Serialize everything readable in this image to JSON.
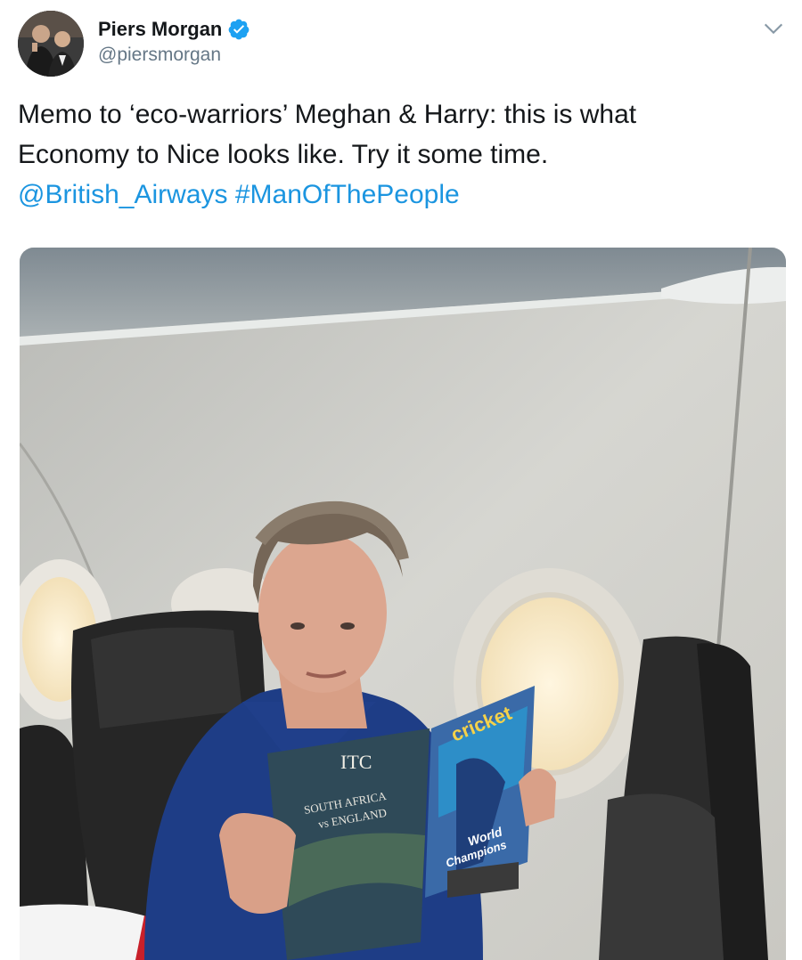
{
  "user": {
    "name": "Piers Morgan",
    "handle": "@piersmorgan",
    "verified_color": "#1da1f2"
  },
  "tweet": {
    "line1": "Memo to ‘eco-warriors’ Meghan & Harry: this is what",
    "line2": "Economy to Nice looks like. Try it some time.",
    "mention": "@British_Airways",
    "hashtag": "#ManOfThePeople",
    "link_color": "#1b95e0"
  },
  "photo": {
    "magazine_left": {
      "masthead": "ITC",
      "headline_1": "SOUTH AFRICA",
      "headline_2": "vs ENGLAND"
    },
    "magazine_right": {
      "masthead": "cricket",
      "cover_line_1": "World",
      "cover_line_2": "Champions"
    }
  },
  "icons": {
    "menu": "chevron-down-icon",
    "verified": "verified-badge-icon"
  }
}
